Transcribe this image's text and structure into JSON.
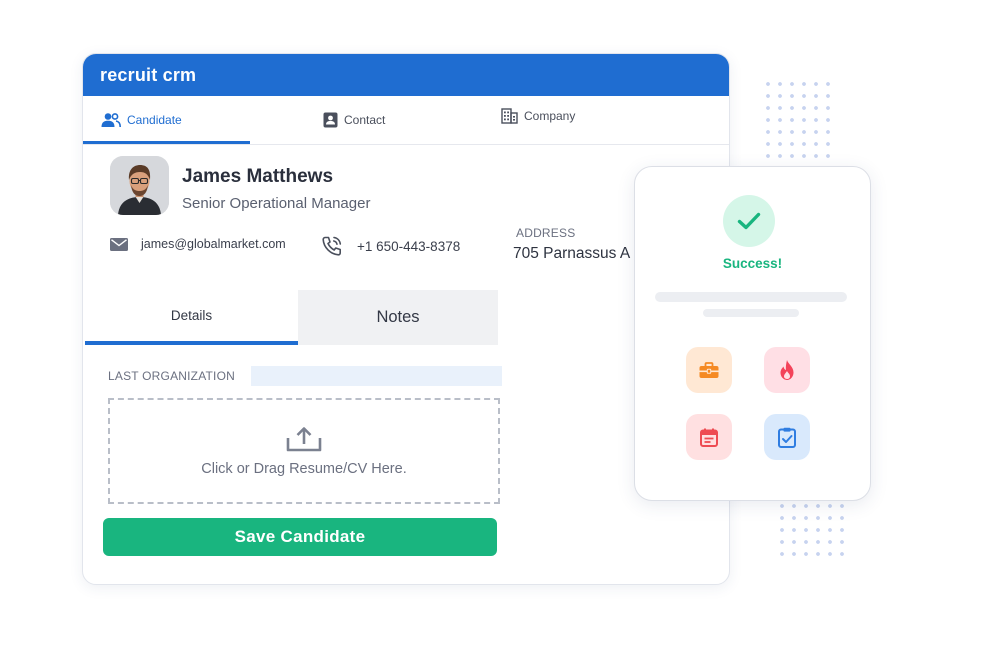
{
  "app": {
    "brand": "recruit crm"
  },
  "top_tabs": [
    {
      "label": "Candidate",
      "icon": "users-icon",
      "active": true
    },
    {
      "label": "Contact",
      "icon": "contact-card-icon",
      "active": false
    },
    {
      "label": "Company",
      "icon": "building-icon",
      "active": false
    }
  ],
  "candidate": {
    "name": "James Matthews",
    "title": "Senior Operational Manager",
    "email": "james@globalmarket.com",
    "phone": "+1 650-443-8378",
    "address_label": "ADDRESS",
    "address_value": "705 Parnassus A"
  },
  "detail_tabs": [
    {
      "label": "Details",
      "active": true
    },
    {
      "label": "Notes",
      "active": false
    }
  ],
  "form": {
    "last_org_label": "LAST ORGANIZATION",
    "last_org_value": "",
    "dropzone_text": "Click or Drag Resume/CV Here.",
    "save_label": "Save Candidate"
  },
  "success_card": {
    "text": "Success!",
    "icons": [
      "briefcase-icon",
      "flame-icon",
      "calendar-icon",
      "clipboard-check-icon"
    ]
  },
  "colors": {
    "brand_blue": "#1f6dd1",
    "success_green": "#19b57f"
  }
}
